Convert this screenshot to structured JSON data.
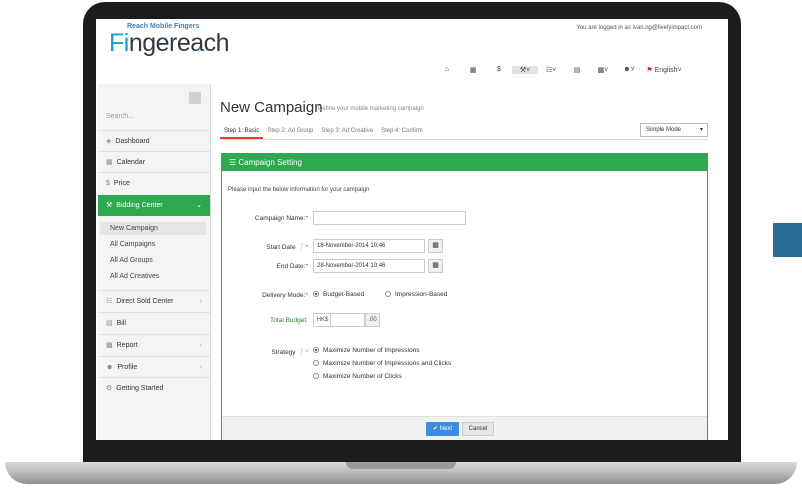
{
  "header": {
    "logo_tagline": "Reach Mobile Fingers",
    "logo_part1": "Fi",
    "logo_part2": "ngereach",
    "logged_in_text": "You are logged in as  ivan.ng@livelyimpact.com",
    "language": "English",
    "icons": [
      "home-icon",
      "calendar-icon",
      "dollar-icon",
      "gavel-icon",
      "sitemap-icon",
      "list-icon",
      "chart-icon",
      "user-icon",
      "flag-icon"
    ]
  },
  "sidebar": {
    "search_placeholder": "Search...",
    "items": [
      {
        "label": "Dashboard",
        "icon": "dashboard-icon"
      },
      {
        "label": "Calendar",
        "icon": "calendar-icon"
      },
      {
        "label": "Price",
        "icon": "dollar-icon"
      },
      {
        "label": "Bidding Center",
        "icon": "gavel-icon"
      },
      {
        "label": "Direct Sold Center",
        "icon": "sitemap-icon"
      },
      {
        "label": "Bill",
        "icon": "bill-icon"
      },
      {
        "label": "Report",
        "icon": "report-icon"
      },
      {
        "label": "Profile",
        "icon": "user-icon"
      },
      {
        "label": "Getting Started",
        "icon": "cogs-icon"
      }
    ],
    "sub_items": [
      "New Campaign",
      "All Campaigns",
      "All Ad Groups",
      "All Ad Creatives"
    ]
  },
  "main": {
    "title": "New Campaign",
    "subtitle": "Define your mobile marketing campaign",
    "steps": [
      "Step 1: Basic",
      "Step 2: Ad Group",
      "Step 3: Ad Creative",
      "Step 4: Confirm"
    ],
    "mode": "Simple Mode",
    "panel_title": "Campaign Setting",
    "intro": "Please input the below information for your campaign",
    "form": {
      "campaign_name_label": "Campaign Name:",
      "campaign_name_value": "",
      "start_date_label": "Start Date",
      "start_date_value": "18-November-2014  10:46",
      "end_date_label": "End Date:",
      "end_date_value": "28-November-2014  10:46",
      "delivery_label": "Delivery Mode:",
      "delivery_options": [
        "Budget-Based",
        "Impression-Based"
      ],
      "budget_label": "Total Budget:",
      "currency": "HK$",
      "budget_value": "",
      "cents": ".00",
      "strategy_label": "Strategy",
      "strategy_options": [
        "Maximize Number of Impressions",
        "Maximize Number of Impressions and Clicks",
        "Maximize Number of Clicks"
      ]
    },
    "buttons": {
      "next": "Next",
      "cancel": "Cancel"
    }
  },
  "colors": {
    "accent_green": "#2fa84f",
    "next_blue": "#3b8de0",
    "required_red": "#e53935"
  }
}
